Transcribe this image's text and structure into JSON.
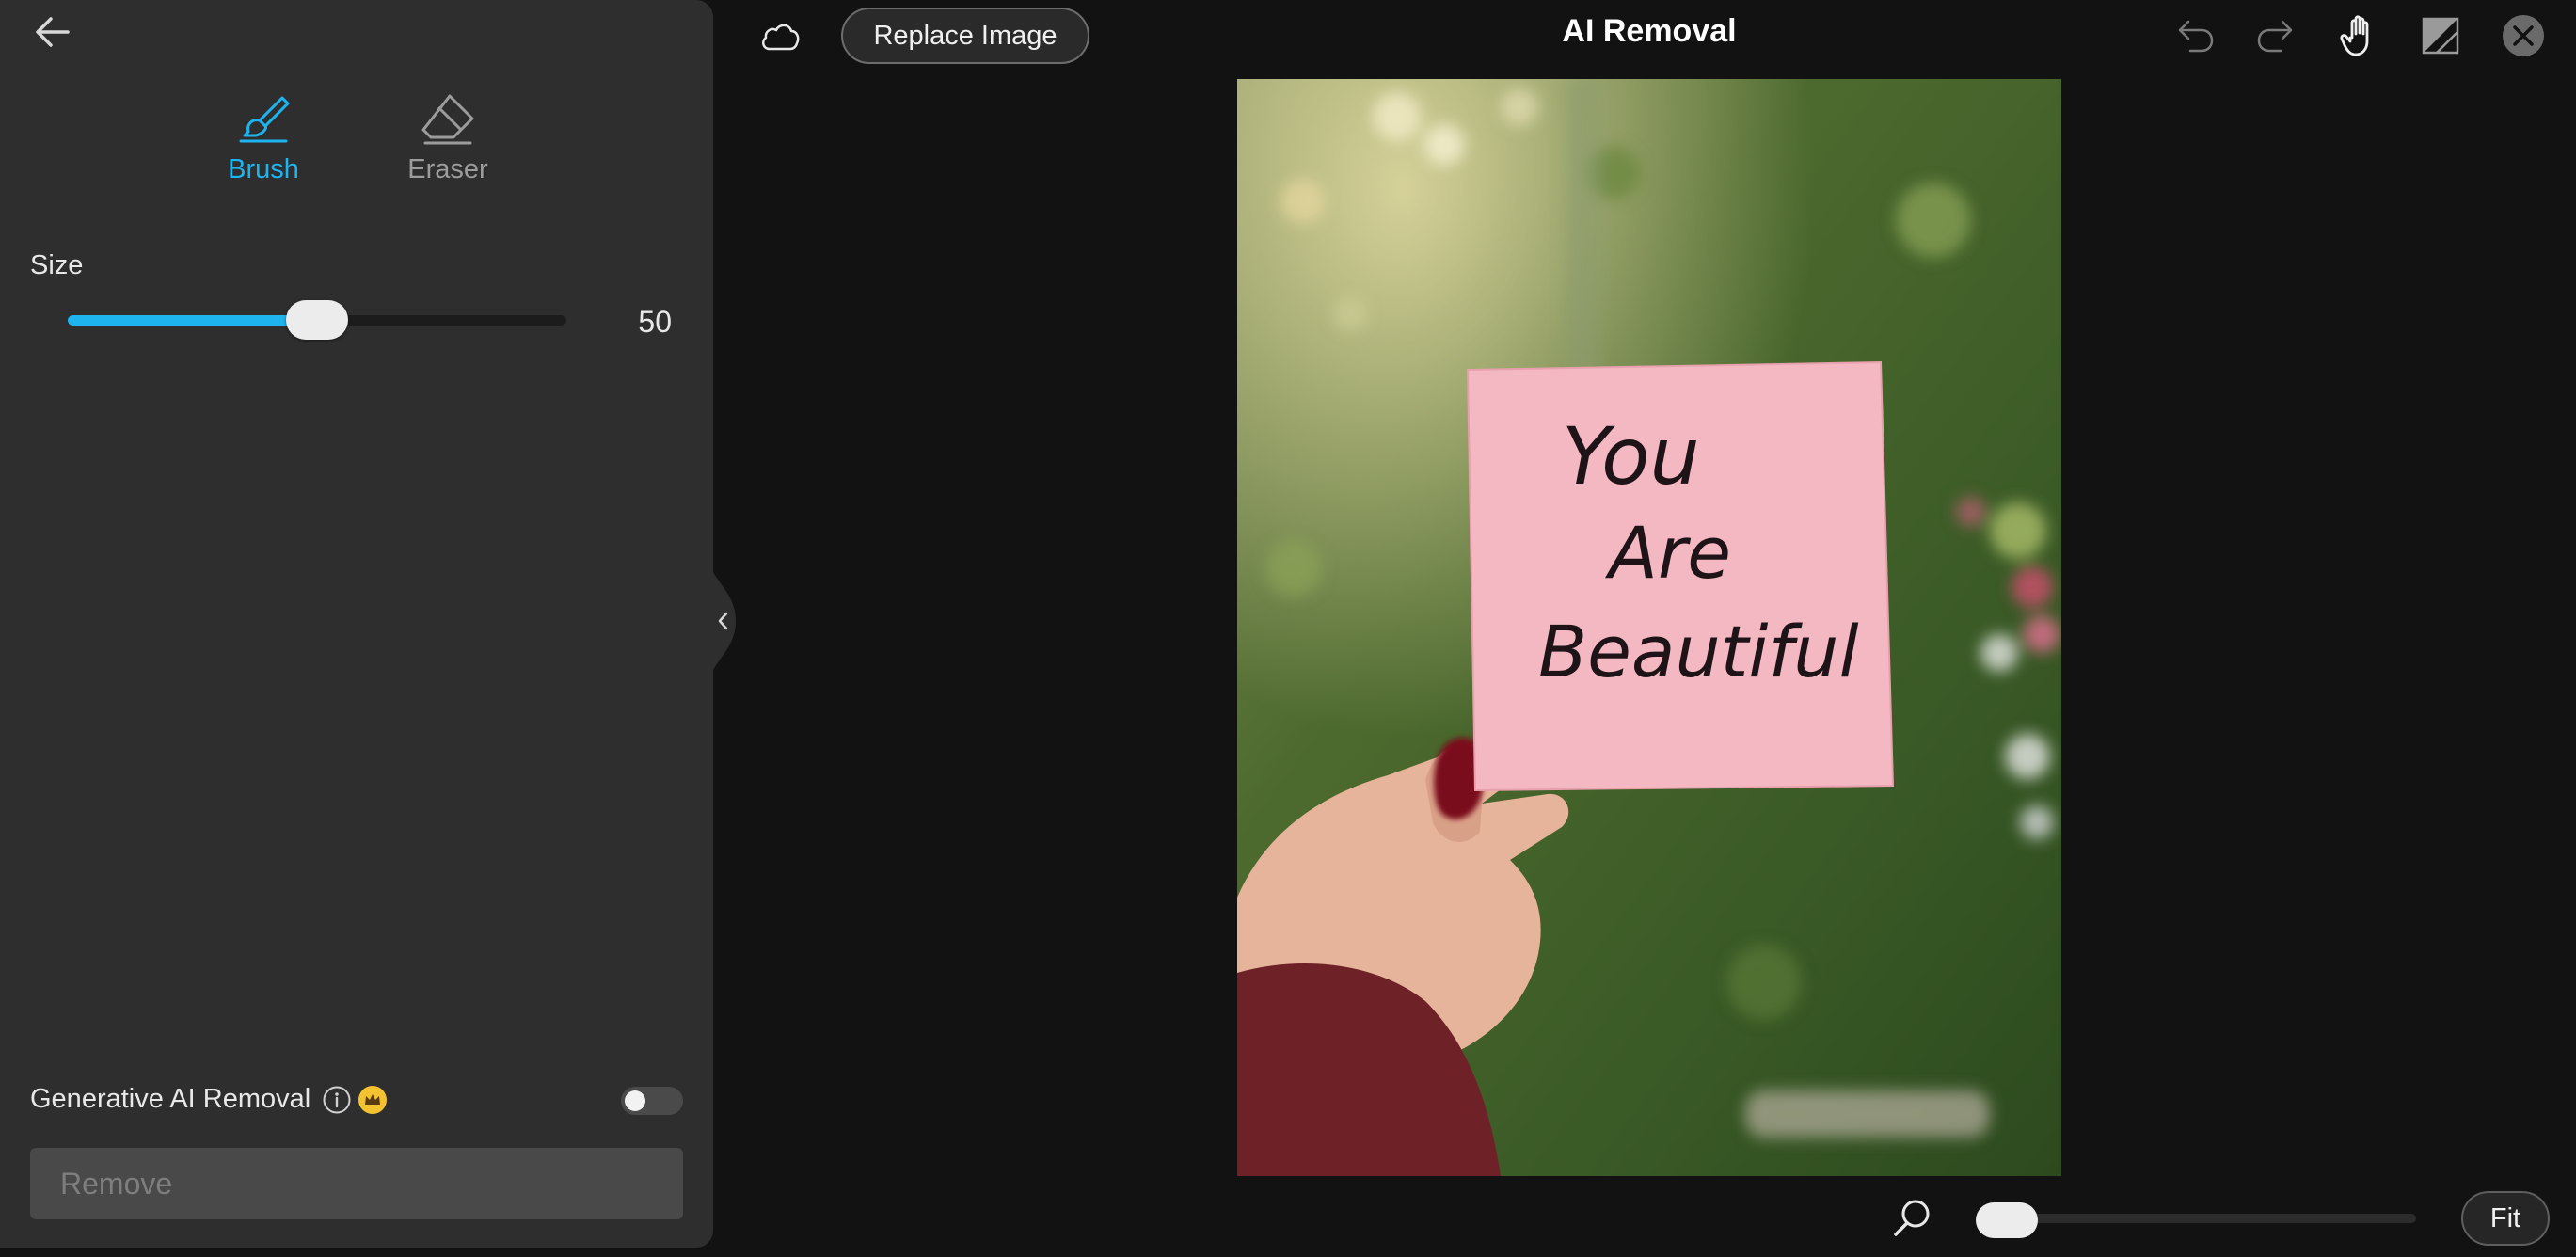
{
  "app": {
    "title": "AI Removal"
  },
  "toolbar": {
    "replace_label": "Replace Image",
    "icons": [
      "back-arrow-icon",
      "cloud-icon",
      "undo-icon",
      "redo-icon",
      "hand-icon",
      "compare-icon",
      "close-icon"
    ]
  },
  "tools": {
    "brush": {
      "label": "Brush",
      "active": true,
      "icon": "brush-icon"
    },
    "eraser": {
      "label": "Eraser",
      "active": false,
      "icon": "eraser-icon"
    }
  },
  "size": {
    "label": "Size",
    "value": "50",
    "level_fraction": 0.5
  },
  "generative": {
    "label": "Generative AI Removal",
    "enabled": false
  },
  "remove": {
    "label": "Remove"
  },
  "image": {
    "note_text": [
      "You",
      "Are",
      "Beautiful"
    ]
  },
  "zoom": {
    "level_fraction": 0.0,
    "fit_label": "Fit"
  },
  "colors": {
    "accent": "#1db4f0",
    "panel": "#2e2e2e",
    "background": "#121212",
    "note": "#f4b8c2",
    "nail": "#8a1020",
    "sweater": "#7a2830"
  }
}
